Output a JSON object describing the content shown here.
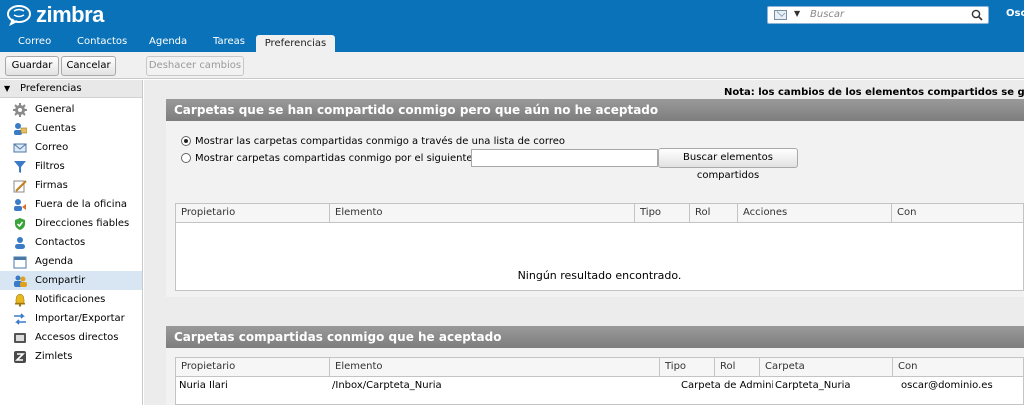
{
  "app": {
    "logo_text": "zimbra",
    "user": "Oscar"
  },
  "search": {
    "placeholder": "Buscar"
  },
  "tabs": [
    {
      "label": "Correo"
    },
    {
      "label": "Contactos"
    },
    {
      "label": "Agenda"
    },
    {
      "label": "Tareas"
    },
    {
      "label": "Preferencias"
    }
  ],
  "toolbar": {
    "save": "Guardar",
    "cancel": "Cancelar",
    "undo": "Deshacer cambios"
  },
  "sidebar": {
    "header": "Preferencias",
    "items": [
      {
        "label": "General",
        "icon": "gear-icon"
      },
      {
        "label": "Cuentas",
        "icon": "accounts-icon"
      },
      {
        "label": "Correo",
        "icon": "mail-icon"
      },
      {
        "label": "Filtros",
        "icon": "filter-icon"
      },
      {
        "label": "Firmas",
        "icon": "signature-icon"
      },
      {
        "label": "Fuera de la oficina",
        "icon": "out-of-office-icon"
      },
      {
        "label": "Direcciones fiables",
        "icon": "shield-icon"
      },
      {
        "label": "Contactos",
        "icon": "contact-icon"
      },
      {
        "label": "Agenda",
        "icon": "calendar-icon"
      },
      {
        "label": "Compartir",
        "icon": "share-icon"
      },
      {
        "label": "Notificaciones",
        "icon": "bell-icon"
      },
      {
        "label": "Importar/Exportar",
        "icon": "import-export-icon"
      },
      {
        "label": "Accesos directos",
        "icon": "shortcuts-icon"
      },
      {
        "label": "Zimlets",
        "icon": "zimlet-icon"
      }
    ]
  },
  "main": {
    "note": "Nota: los cambios de los elementos compartidos se guardan inmediatamente.",
    "pending": {
      "title": "Carpetas que se han compartido conmigo pero que aún no he aceptado",
      "radio1": "Mostrar las carpetas compartidas conmigo a través de una lista de correo",
      "radio2": "Mostrar carpetas compartidas conmigo por el siguiente usuario:",
      "user_value": "",
      "find_button": "Buscar elementos compartidos",
      "columns": [
        "Propietario",
        "Elemento",
        "Tipo",
        "Rol",
        "Acciones",
        "Con"
      ],
      "empty": "Ningún resultado encontrado."
    },
    "accepted": {
      "title": "Carpetas compartidas conmigo que he aceptado",
      "columns": [
        "Propietario",
        "Elemento",
        "Tipo",
        "Rol",
        "Carpeta",
        "Con"
      ],
      "rows": [
        {
          "owner": "Nuria Ilari",
          "item": "/Inbox/Carpteta_Nuria",
          "type": "Carpeta de Administ",
          "role": "",
          "folder": "Carpteta_Nuria",
          "with": "oscar@dominio.es"
        }
      ]
    }
  },
  "colors": {
    "brand": "#0a72b8",
    "panel_header": "#8a8a8a",
    "selected": "#d8e6f3"
  }
}
